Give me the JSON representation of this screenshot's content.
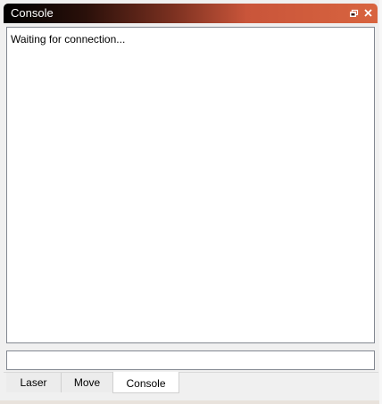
{
  "window": {
    "title": "Console",
    "float_icon": "float-window-icon",
    "close_icon": "close-icon"
  },
  "console": {
    "output_text": "Waiting for connection...",
    "input_value": ""
  },
  "tabs": [
    {
      "label": "Laser",
      "active": false
    },
    {
      "label": "Move",
      "active": false
    },
    {
      "label": "Console",
      "active": true
    }
  ],
  "colors": {
    "titlebar_gradient_start": "#000000",
    "titlebar_gradient_end": "#d8643f",
    "panel_background": "#f0f0f0",
    "console_background": "#ffffff"
  }
}
